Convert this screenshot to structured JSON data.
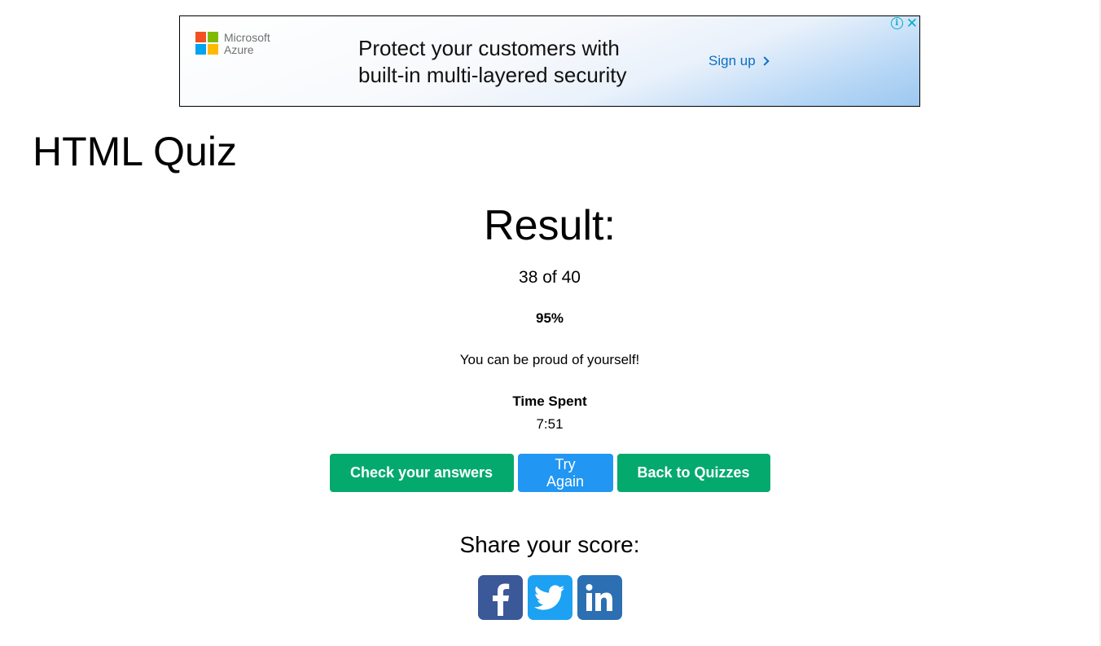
{
  "ad": {
    "brand_line1": "Microsoft",
    "brand_line2": "Azure",
    "headline_line1": "Protect your customers with",
    "headline_line2": "built-in multi-layered security",
    "cta": "Sign up",
    "info_symbol": "i",
    "close_symbol": "✕",
    "colors": {
      "logo_red": "#f25022",
      "logo_green": "#7fba00",
      "logo_blue": "#00a4ef",
      "logo_yellow": "#ffb900",
      "cta": "#0b6fc2",
      "ad_controls": "#00aecd"
    }
  },
  "page_title": "HTML Quiz",
  "result": {
    "heading": "Result:",
    "score": "38 of 40",
    "percent": "95%",
    "message": "You can be proud of yourself!",
    "time_label": "Time Spent",
    "time_value": "7:51"
  },
  "buttons": {
    "check_answers": "Check your answers",
    "try_again": "Try Again",
    "back_to_quizzes": "Back to Quizzes",
    "colors": {
      "green": "#04aa6d",
      "blue": "#2196f3"
    }
  },
  "share": {
    "heading": "Share your score:",
    "icons": [
      "facebook-icon",
      "twitter-icon",
      "linkedin-icon"
    ],
    "colors": {
      "facebook": "#3b5998",
      "twitter": "#1da1f2",
      "linkedin": "#2c6fb2"
    }
  }
}
